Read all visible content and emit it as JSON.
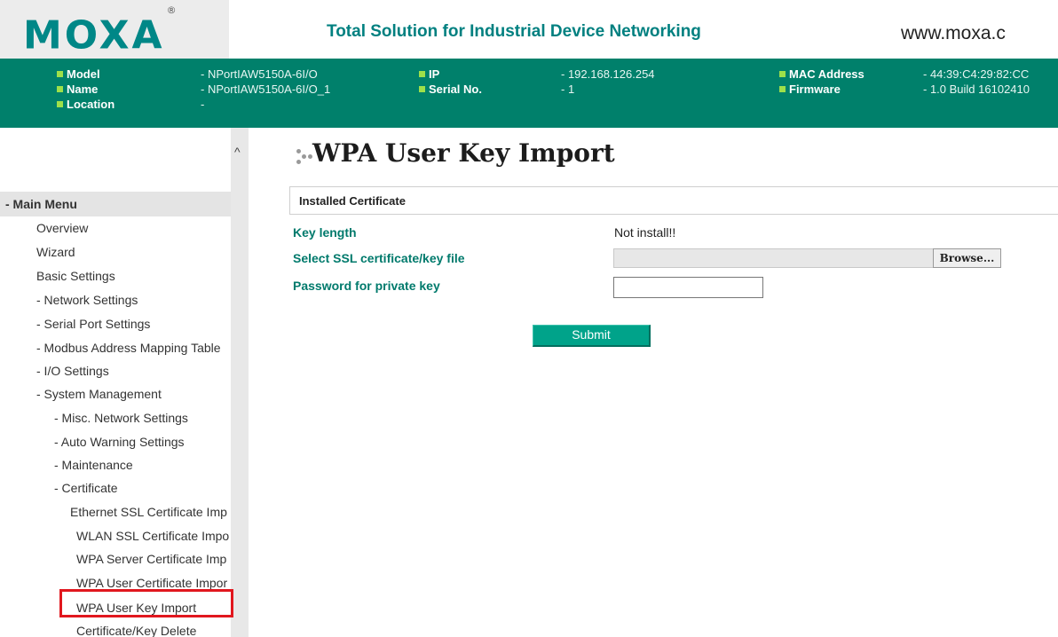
{
  "header": {
    "logo_text": "MOXA",
    "logo_mark": "®",
    "tagline": "Total Solution for Industrial Device Networking",
    "website": "www.moxa.c"
  },
  "device_info": {
    "model_label": "Model",
    "model_value": "- NPortIAW5150A-6I/O",
    "name_label": "Name",
    "name_value": "- NPortIAW5150A-6I/O_1",
    "location_label": "Location",
    "location_value": "-",
    "ip_label": "IP",
    "ip_value": "- 192.168.126.254",
    "serial_label": "Serial No.",
    "serial_value": "- 1",
    "mac_label": "MAC Address",
    "mac_value": "- 44:39:C4:29:82:CC",
    "firmware_label": "Firmware",
    "firmware_value": "- 1.0 Build 16102410"
  },
  "sidebar": {
    "scroll_up": "^",
    "main_menu": "- Main Menu",
    "items": [
      "Overview",
      "Wizard",
      "Basic Settings",
      "- Network Settings",
      "- Serial Port Settings",
      "- Modbus Address Mapping Table",
      "- I/O Settings",
      "- System Management",
      "- Misc. Network Settings",
      "- Auto Warning Settings",
      "- Maintenance",
      "- Certificate",
      "Ethernet SSL Certificate Imp",
      "WLAN SSL Certificate Impo",
      "WPA Server Certificate Imp",
      "WPA User Certificate Impor",
      "WPA User Key Import",
      "Certificate/Key Delete"
    ],
    "selected": "WPA User Key Import"
  },
  "main": {
    "title": "WPA User Key Import",
    "section_title": "Installed Certificate",
    "key_length_label": "Key length",
    "key_length_value": "Not install!!",
    "select_file_label": "Select SSL certificate/key file",
    "browse_label": "Browse...",
    "password_label": "Password for private key",
    "password_value": "",
    "submit_label": "Submit"
  },
  "colors": {
    "brand_teal": "#008787",
    "info_bar": "#00806b",
    "label_teal": "#007a6c",
    "submit_button": "#00a38a",
    "highlight_box": "#e1171e"
  }
}
